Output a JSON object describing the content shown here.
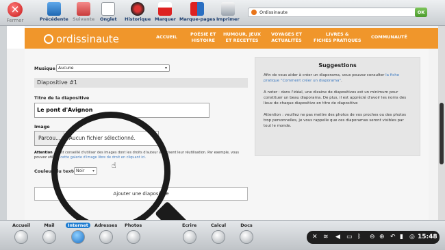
{
  "toolbar": {
    "close_label": "Fermer",
    "items": [
      {
        "label": "Précédente"
      },
      {
        "label": "Suivante"
      },
      {
        "label": "Onglet"
      },
      {
        "label": "Historique"
      },
      {
        "label": "Marquer"
      },
      {
        "label": "Marque-pages"
      },
      {
        "label": "Imprimer"
      }
    ],
    "url": "Ordissinaute",
    "ok_label": "OK"
  },
  "site": {
    "logo": "ordissinaute",
    "nav": [
      {
        "line1": "ACCUEIL",
        "line2": ""
      },
      {
        "line1": "POÉSIE ET",
        "line2": "HISTOIRE"
      },
      {
        "line1": "HUMOUR, JEUX",
        "line2": "ET RECETTES"
      },
      {
        "line1": "VOYAGES ET",
        "line2": "ACTUALITÉS"
      },
      {
        "line1": "LIVRES &",
        "line2": "FICHES PRATIQUES"
      },
      {
        "line1": "COMMUNAUTÉ",
        "line2": ""
      }
    ],
    "facebook": "f"
  },
  "form": {
    "musique_label": "Musique",
    "musique_value": "Aucune",
    "slide_title": "Diapositive #1",
    "titre_label": "Titre de la diapositive",
    "titre_value": "Le pont d'Avignon",
    "image_label": "Image",
    "browse_label": "Parcou...",
    "file_status": "Aucun fichier sélectionné.",
    "attention_bold": "Attention",
    "attention_text": " : il est conseillé d'utiliser des images dont les droits d'auteur autorisent leur réutilisation. Par exemple, vous pouvez utiliser ",
    "attention_link": "cette galerie d'image libre de droit en cliquant ici.",
    "couleur_label": "Couleur du texte",
    "couleur_value": "Noir",
    "add_button": "Ajouter une diapositive"
  },
  "suggestions": {
    "title": "Suggestions",
    "p1_start": "Afin de vous aider à créer un diaporama, vous pouvez consulter ",
    "p1_link": "la fiche pratique \"Comment créer un diaporama\"",
    "p1_end": ".",
    "p2": "A noter : dans l'idéal, une dizaine de diapositives est un minimum pour constituer un beau diaporama. De plus, il est apprécié d'avoir les noms des lieux de chaque diapositive en titre de diapositive",
    "p3": "Attention : veuillez ne pas mettre des photos de vos proches ou des photos trop personnelles, je vous rappelle que ces diaporamas seront visibles par tout le monde."
  },
  "dock": {
    "items": [
      {
        "label": "Accueil"
      },
      {
        "label": "Mail"
      },
      {
        "label": "Internet"
      },
      {
        "label": "Adresses"
      },
      {
        "label": "Photos"
      },
      {
        "label": "Ecrire"
      },
      {
        "label": "Calcul"
      },
      {
        "label": "Docs"
      }
    ],
    "clock": "15:48"
  },
  "colors": {
    "brand_orange": "#f0962b",
    "link_blue": "#3a78c0",
    "ok_green": "#4b9a2c",
    "close_red": "#c61818"
  }
}
